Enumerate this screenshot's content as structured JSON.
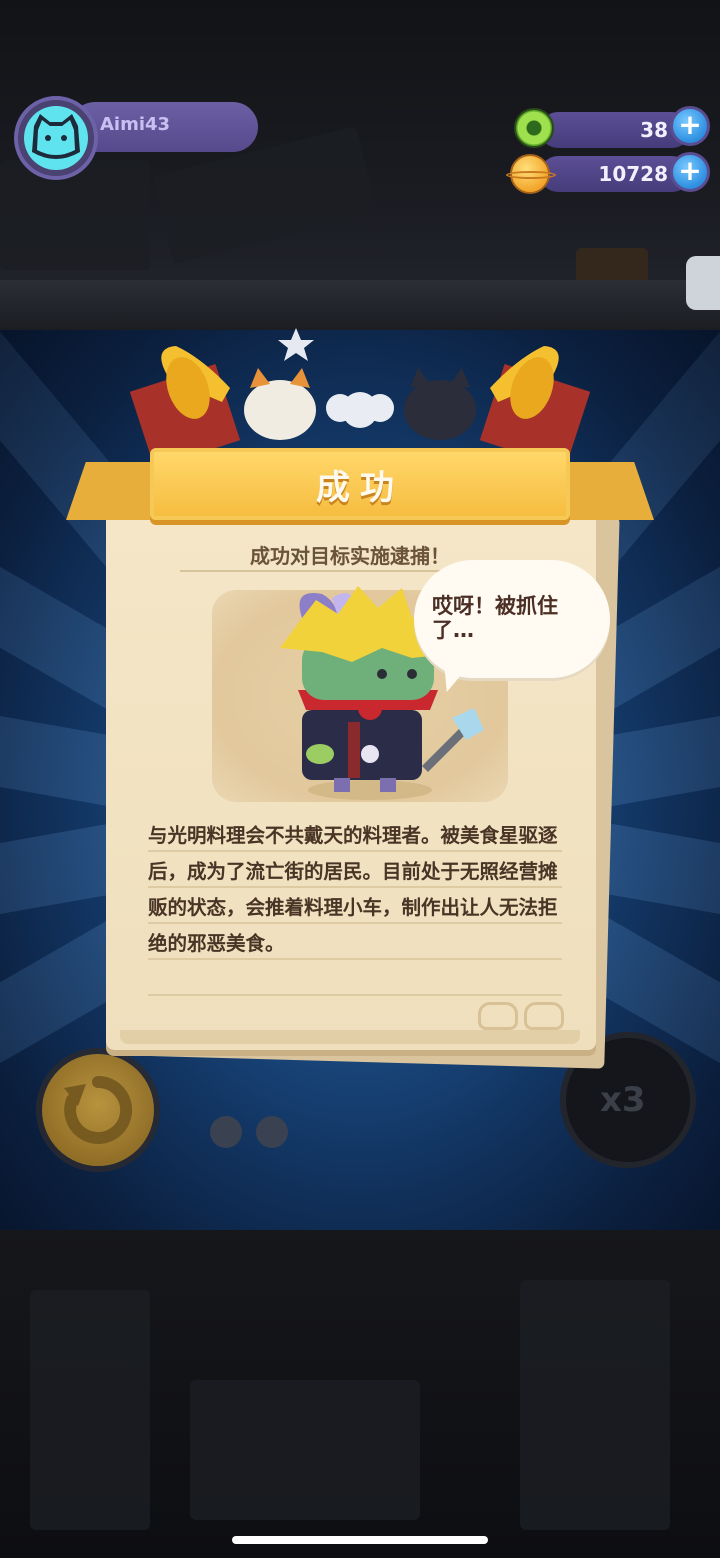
{
  "player": {
    "name": "Aimi43",
    "avatar_icon": "cat-face-icon"
  },
  "currencies": [
    {
      "name": "donut",
      "icon": "donut-icon",
      "value": "38",
      "add_label": "+"
    },
    {
      "name": "coin",
      "icon": "coin-icon",
      "value": "10728",
      "add_label": "+"
    }
  ],
  "result": {
    "title": "成功",
    "subtitle": "成功对目标实施逮捕！",
    "speech": "哎呀！被抓住了…",
    "description": "与光明料理会不共戴天的料理者。被美食星驱逐后，成为了流亡街的居民。目前处于无照经营摊贩的状态，会推着料理小车，制作出让人无法拒绝的邪恶美食。"
  },
  "controls": {
    "speed_label": "x3",
    "replay_icon": "replay-icon"
  },
  "colors": {
    "banner": "#f6bd40",
    "paper": "#f4e6c7",
    "hud_bar": "#564a8c",
    "plus": "#2e8fe0"
  }
}
